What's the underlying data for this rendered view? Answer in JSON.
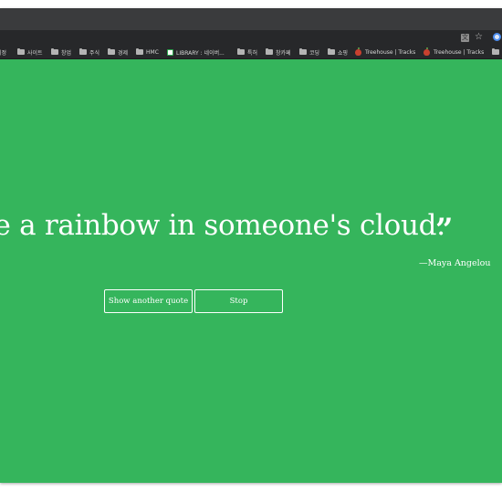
{
  "browser": {
    "toolbar_icons": [
      "translate-icon",
      "star-icon",
      "profile-icon"
    ],
    "translate_glyph": "文",
    "star_glyph": "☆",
    "bookmarks": [
      {
        "label": "계정",
        "icon": "folder-icon"
      },
      {
        "label": "사이트",
        "icon": "folder-icon"
      },
      {
        "label": "창업",
        "icon": "folder-icon"
      },
      {
        "label": "주식",
        "icon": "folder-icon"
      },
      {
        "label": "경제",
        "icon": "folder-icon"
      },
      {
        "label": "HMC",
        "icon": "folder-icon"
      },
      {
        "label": "LIBRARY : 네이버...",
        "icon": "favicon-icon"
      },
      {
        "label": "특허",
        "icon": "folder-icon"
      },
      {
        "label": "창카페",
        "icon": "folder-icon"
      },
      {
        "label": "코딩",
        "icon": "folder-icon"
      },
      {
        "label": "쇼핑",
        "icon": "folder-icon"
      },
      {
        "label": "Treehouse | Tracks",
        "icon": "apple-icon"
      },
      {
        "label": "Treehouse | Tracks",
        "icon": "apple-icon"
      }
    ]
  },
  "page": {
    "background_color": "#35b55c",
    "quote": "be a rainbow in someone's cloud.",
    "quote_mark": "”",
    "author": "—Maya Angelou",
    "buttons": {
      "next_label": "Show another quote",
      "stop_label": "Stop"
    }
  }
}
